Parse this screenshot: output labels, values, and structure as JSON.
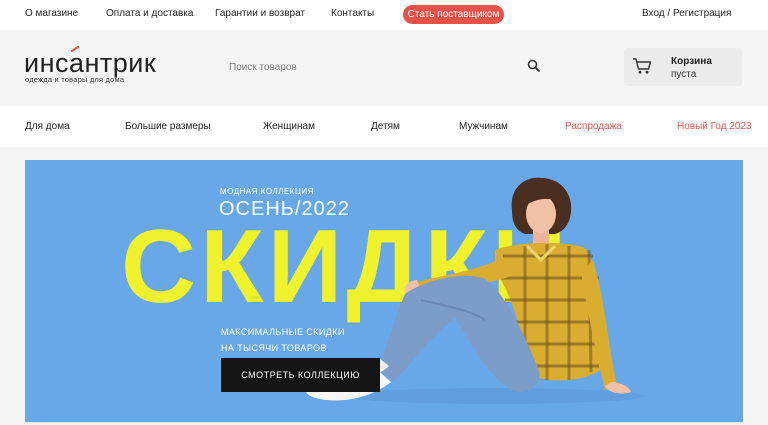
{
  "topbar": {
    "links": [
      "О магазине",
      "Оплата и доставка",
      "Гарантии и возврат",
      "Контакты"
    ],
    "supplier_button": "Стать поставщиком",
    "auth": "Вход / Регистрация"
  },
  "header": {
    "logo_main": "инсантрик",
    "logo_sub": "одежда и товары для дома",
    "search_placeholder": "Поиск товаров",
    "cart_title": "Корзина",
    "cart_status": "пуста"
  },
  "categories": [
    {
      "label": "Для дома"
    },
    {
      "label": "Большие размеры"
    },
    {
      "label": "Женщинам"
    },
    {
      "label": "Детям"
    },
    {
      "label": "Мужчинам"
    },
    {
      "label": "Распродажа",
      "highlight": true
    },
    {
      "label": "Новый Год 2023",
      "highlight": true
    }
  ],
  "banner": {
    "kicker": "МОДНАЯ КОЛЛЕКЦИЯ",
    "season": "ОСЕНЬ/2022",
    "big_word": "СКИДКИ",
    "subtitle_line1": "МАКСИМАЛЬНЫЕ СКИДКИ",
    "subtitle_line2": "НА ТЫСЯЧИ ТОВАРОВ",
    "button": "СМОТРЕТЬ КОЛЛЕКЦИЮ"
  },
  "colors": {
    "accent": "#e9524a",
    "banner_bg": "#68a8e9",
    "banner_headline": "#f0f22d",
    "banner_button": "#151515"
  },
  "icons": {
    "search": "search-icon",
    "cart": "cart-icon"
  }
}
